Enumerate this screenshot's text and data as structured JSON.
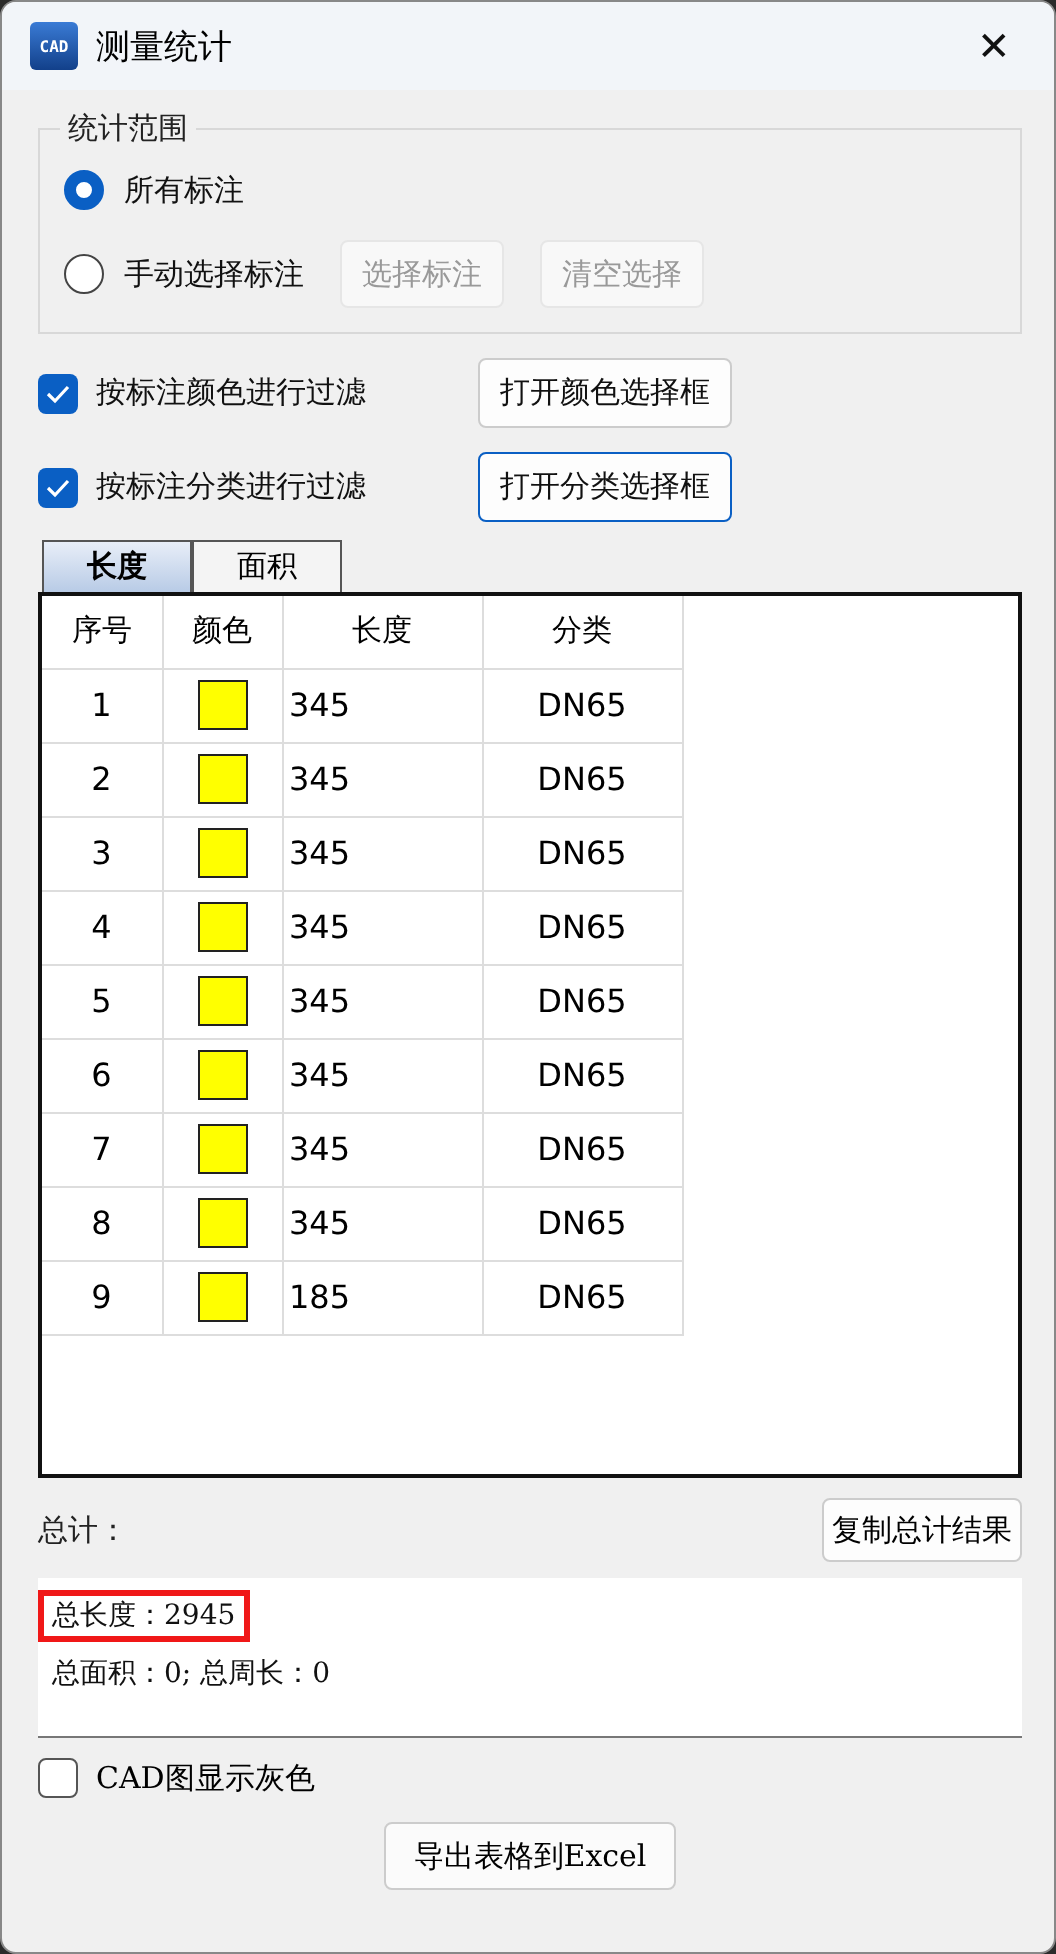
{
  "window": {
    "icon_text": "CAD",
    "title": "测量统计",
    "close": "✕"
  },
  "scope": {
    "legend": "统计范围",
    "options": [
      {
        "label": "所有标注",
        "selected": true
      },
      {
        "label": "手动选择标注",
        "selected": false
      }
    ],
    "buttons": [
      {
        "label": "选择标注",
        "disabled": true
      },
      {
        "label": "清空选择",
        "disabled": true
      }
    ]
  },
  "filters": [
    {
      "label": "按标注颜色进行过滤",
      "checked": true,
      "button": "打开颜色选择框",
      "focused": false
    },
    {
      "label": "按标注分类进行过滤",
      "checked": true,
      "button": "打开分类选择框",
      "focused": true
    }
  ],
  "tabs": [
    {
      "label": "长度",
      "selected": true
    },
    {
      "label": "面积",
      "selected": false
    }
  ],
  "table": {
    "columns": [
      "序号",
      "颜色",
      "长度",
      "分类"
    ],
    "rows": [
      {
        "index": "1",
        "color": "#ffff00",
        "length": "345",
        "category": "DN65"
      },
      {
        "index": "2",
        "color": "#ffff00",
        "length": "345",
        "category": "DN65"
      },
      {
        "index": "3",
        "color": "#ffff00",
        "length": "345",
        "category": "DN65"
      },
      {
        "index": "4",
        "color": "#ffff00",
        "length": "345",
        "category": "DN65"
      },
      {
        "index": "5",
        "color": "#ffff00",
        "length": "345",
        "category": "DN65"
      },
      {
        "index": "6",
        "color": "#ffff00",
        "length": "345",
        "category": "DN65"
      },
      {
        "index": "7",
        "color": "#ffff00",
        "length": "345",
        "category": "DN65"
      },
      {
        "index": "8",
        "color": "#ffff00",
        "length": "345",
        "category": "DN65"
      },
      {
        "index": "9",
        "color": "#ffff00",
        "length": "185",
        "category": "DN65"
      }
    ]
  },
  "summary": {
    "label": "总计：",
    "copy_button": "复制总计结果",
    "lines": [
      {
        "text": "总长度：2945",
        "highlighted": true
      },
      {
        "text": "总面积：0; 总周长：0",
        "highlighted": false
      }
    ]
  },
  "gray_option": {
    "label": "CAD图显示灰色",
    "checked": false
  },
  "export_button": "导出表格到Excel"
}
